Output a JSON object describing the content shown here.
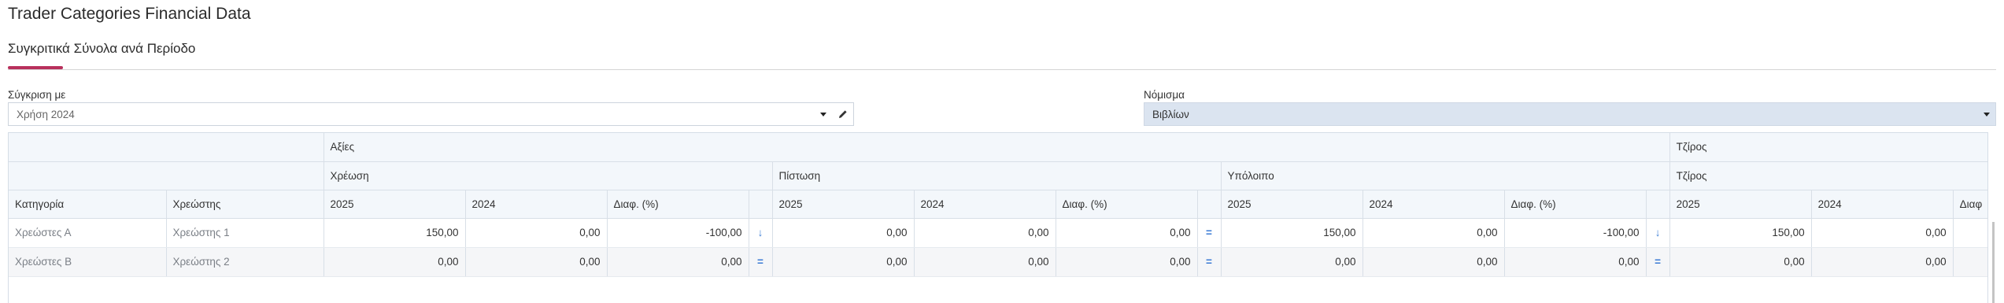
{
  "page": {
    "title": "Trader Categories Financial Data"
  },
  "tabs": [
    {
      "label": "Συγκριτικά Σύνολα ανά Περίοδο",
      "active": true
    }
  ],
  "filters": {
    "compare": {
      "label": "Σύγκριση με",
      "value": "Χρήση 2024"
    },
    "currency": {
      "label": "Νόμισμα",
      "value": "Βιβλίων"
    }
  },
  "grid": {
    "group1": {
      "values": "Αξίες",
      "turnover": "Τζίρος"
    },
    "group2": {
      "debit": "Χρέωση",
      "credit": "Πίστωση",
      "balance": "Υπόλοιπο",
      "turnover": "Τζίρος"
    },
    "cols": {
      "category": "Κατηγορία",
      "debtor": "Χρεώστης",
      "y2025": "2025",
      "y2024": "2024",
      "diff": "Διαφ. (%)",
      "diff_clipped": "Διαφ"
    },
    "rows": [
      {
        "category": "Χρεώστες Α",
        "debtor": "Χρεώστης 1",
        "debit": [
          "150,00",
          "0,00",
          "-100,00"
        ],
        "debit_ind": "↓",
        "credit": [
          "0,00",
          "0,00",
          "0,00"
        ],
        "credit_ind": "=",
        "balance": [
          "150,00",
          "0,00",
          "-100,00"
        ],
        "balance_ind": "↓",
        "turnover": [
          "150,00",
          "0,00"
        ]
      },
      {
        "category": "Χρεώστες Β",
        "debtor": "Χρεώστης 2",
        "debit": [
          "0,00",
          "0,00",
          "0,00"
        ],
        "debit_ind": "=",
        "credit": [
          "0,00",
          "0,00",
          "0,00"
        ],
        "credit_ind": "=",
        "balance": [
          "0,00",
          "0,00",
          "0,00"
        ],
        "balance_ind": "=",
        "turnover": [
          "0,00",
          "0,00"
        ]
      }
    ]
  },
  "colors": {
    "accent": "#b8305c",
    "indicator": "#3a7bd5",
    "header_bg": "#f3f7fb",
    "select_bg": "#dbe4f0"
  }
}
